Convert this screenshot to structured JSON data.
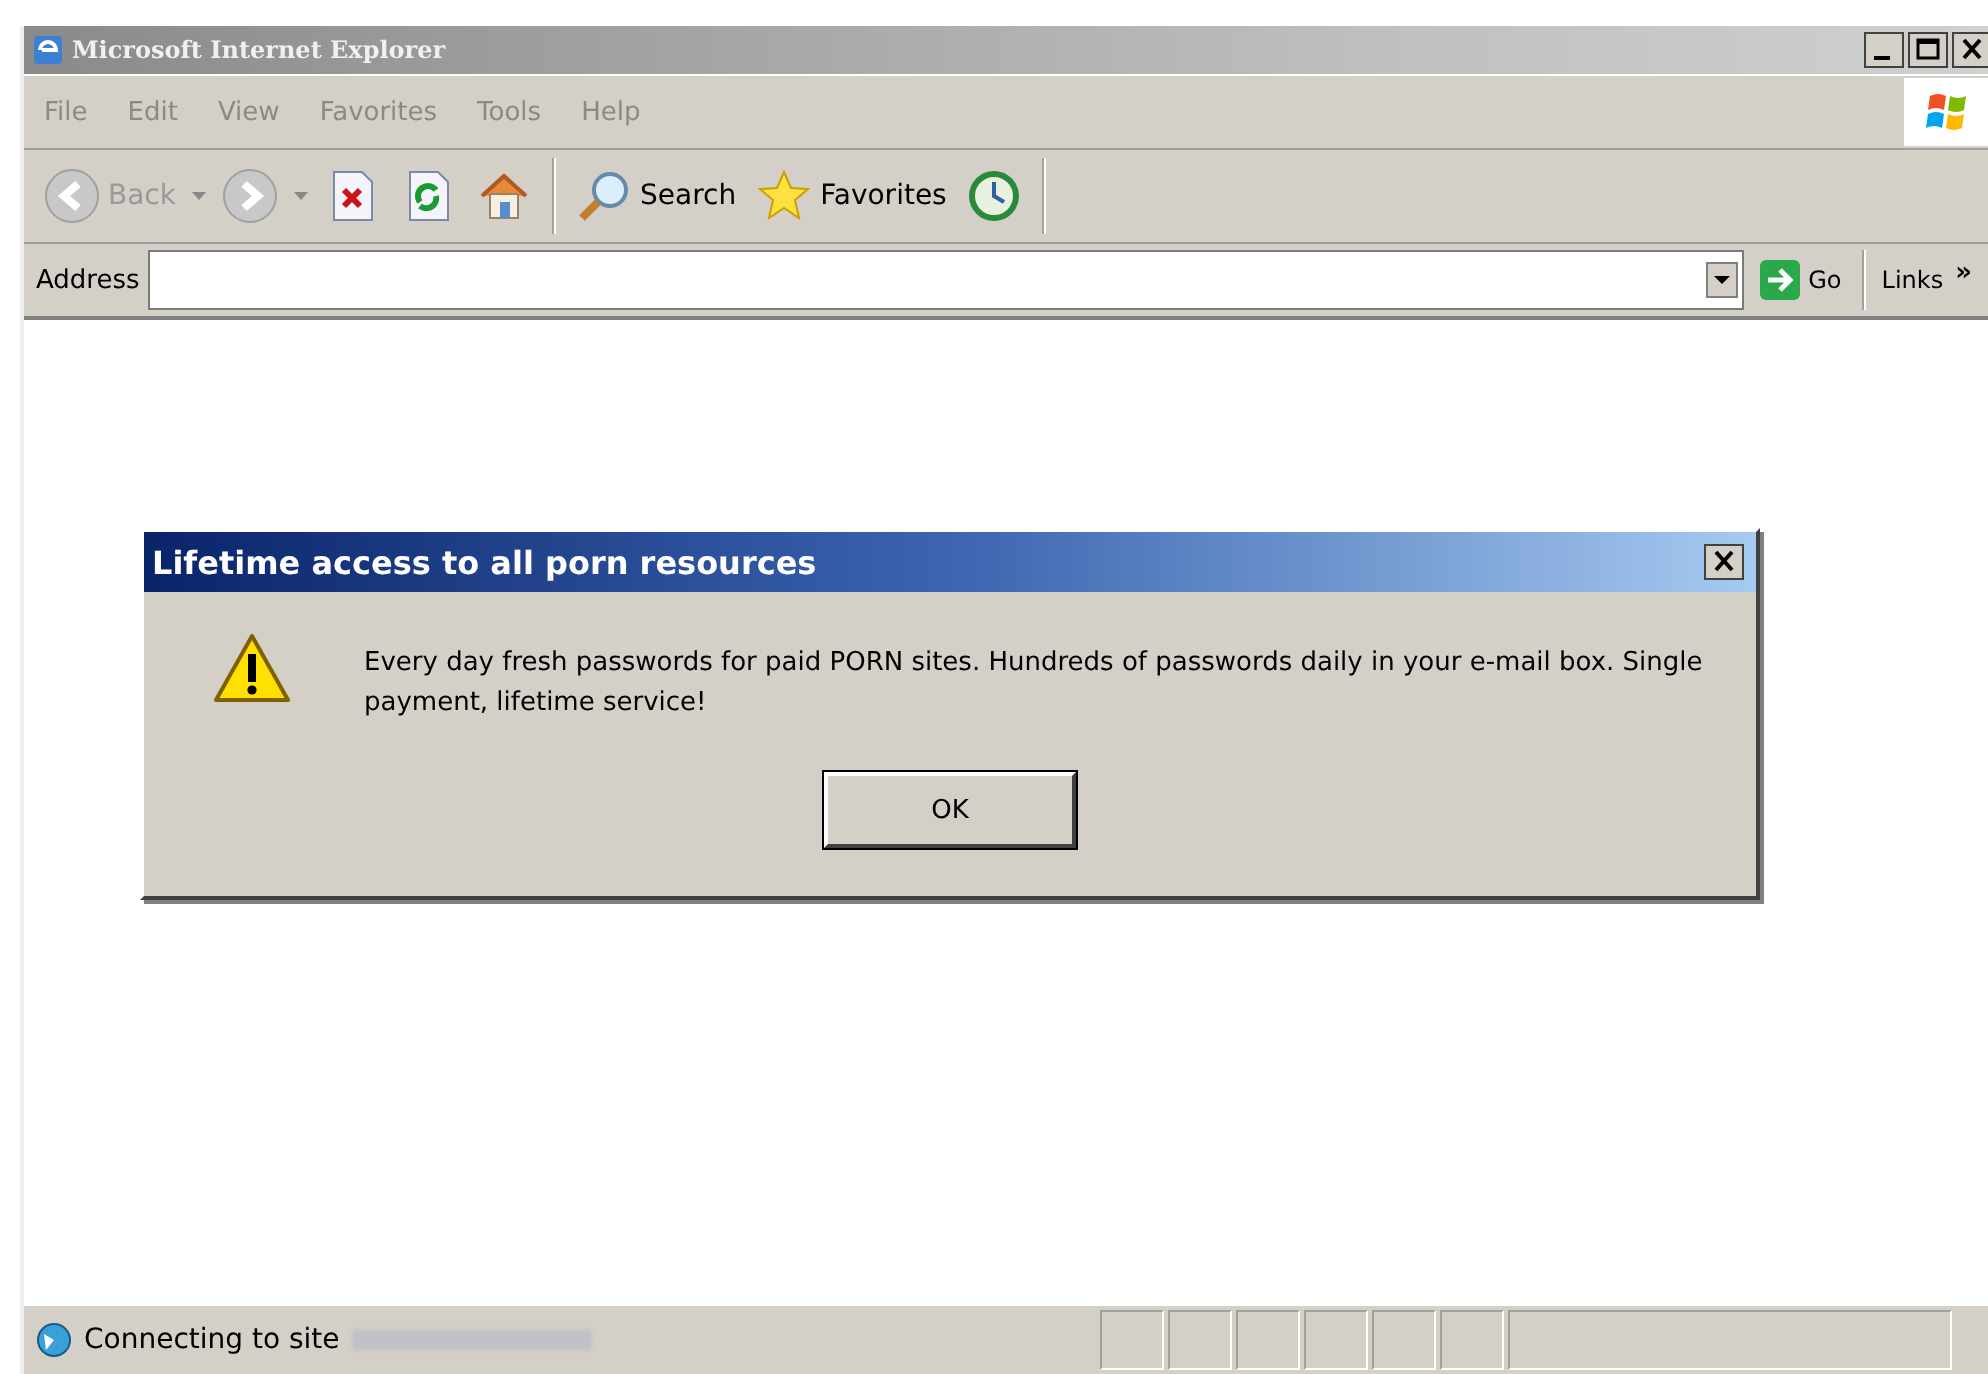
{
  "window": {
    "title": "Microsoft Internet Explorer"
  },
  "menu": [
    {
      "label": "File"
    },
    {
      "label": "Edit"
    },
    {
      "label": "View"
    },
    {
      "label": "Favorites"
    },
    {
      "label": "Tools"
    },
    {
      "label": "Help"
    }
  ],
  "toolbar": [
    {
      "kind": "back",
      "label": "Back",
      "disabled": true
    },
    {
      "kind": "forward",
      "disabled": true
    },
    {
      "kind": "stop"
    },
    {
      "kind": "refresh"
    },
    {
      "kind": "home"
    },
    {
      "kind": "search",
      "label": "Search"
    },
    {
      "kind": "favorites",
      "label": "Favorites"
    },
    {
      "kind": "history"
    }
  ],
  "address_bar": {
    "label": "Address",
    "go": "Go",
    "links": "Links",
    "more": "»"
  },
  "dialog": {
    "title": "Lifetime access to all porn resources",
    "message": "Every day fresh passwords for paid PORN sites. Hundreds of passwords daily in your e-mail box. Single payment, lifetime service!",
    "buttons": [
      "OK"
    ]
  },
  "status_bar": {
    "text": "Connecting to site"
  }
}
